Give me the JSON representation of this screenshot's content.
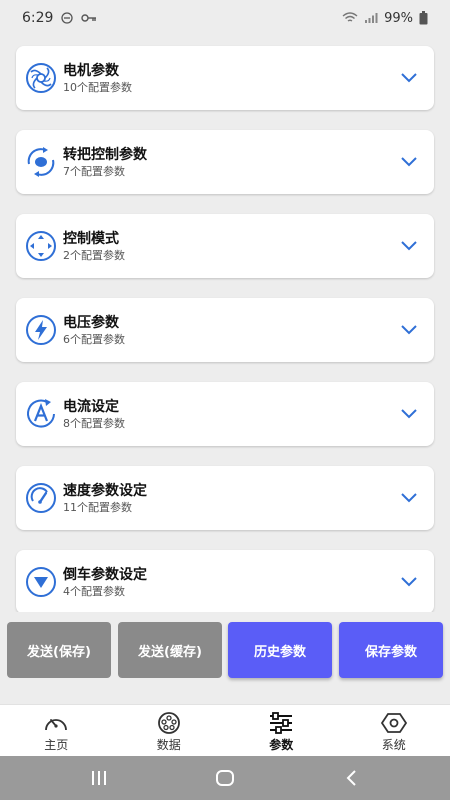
{
  "status_bar": {
    "time": "6:29",
    "battery": "99%"
  },
  "params": [
    {
      "title": "电机参数",
      "subtitle": "10个配置参数",
      "icon": "fan-icon"
    },
    {
      "title": "转把控制参数",
      "subtitle": "7个配置参数",
      "icon": "rotate-icon"
    },
    {
      "title": "控制模式",
      "subtitle": "2个配置参数",
      "icon": "direction-pad-icon"
    },
    {
      "title": "电压参数",
      "subtitle": "6个配置参数",
      "icon": "lightning-icon"
    },
    {
      "title": "电流设定",
      "subtitle": "8个配置参数",
      "icon": "ampere-icon"
    },
    {
      "title": "速度参数设定",
      "subtitle": "11个配置参数",
      "icon": "speedometer-icon"
    },
    {
      "title": "倒车参数设定",
      "subtitle": "4个配置参数",
      "icon": "reverse-down-icon"
    }
  ],
  "actions": {
    "send_save": "发送(保存)",
    "send_cache": "发送(缓存)",
    "history": "历史参数",
    "save": "保存参数"
  },
  "nav": {
    "home": "主页",
    "data": "数据",
    "params": "参数",
    "system": "系统",
    "active": "params"
  },
  "colors": {
    "accent": "#5a5df7",
    "icon_blue": "#2f6fd6",
    "gray_button": "#8a8a8a"
  }
}
